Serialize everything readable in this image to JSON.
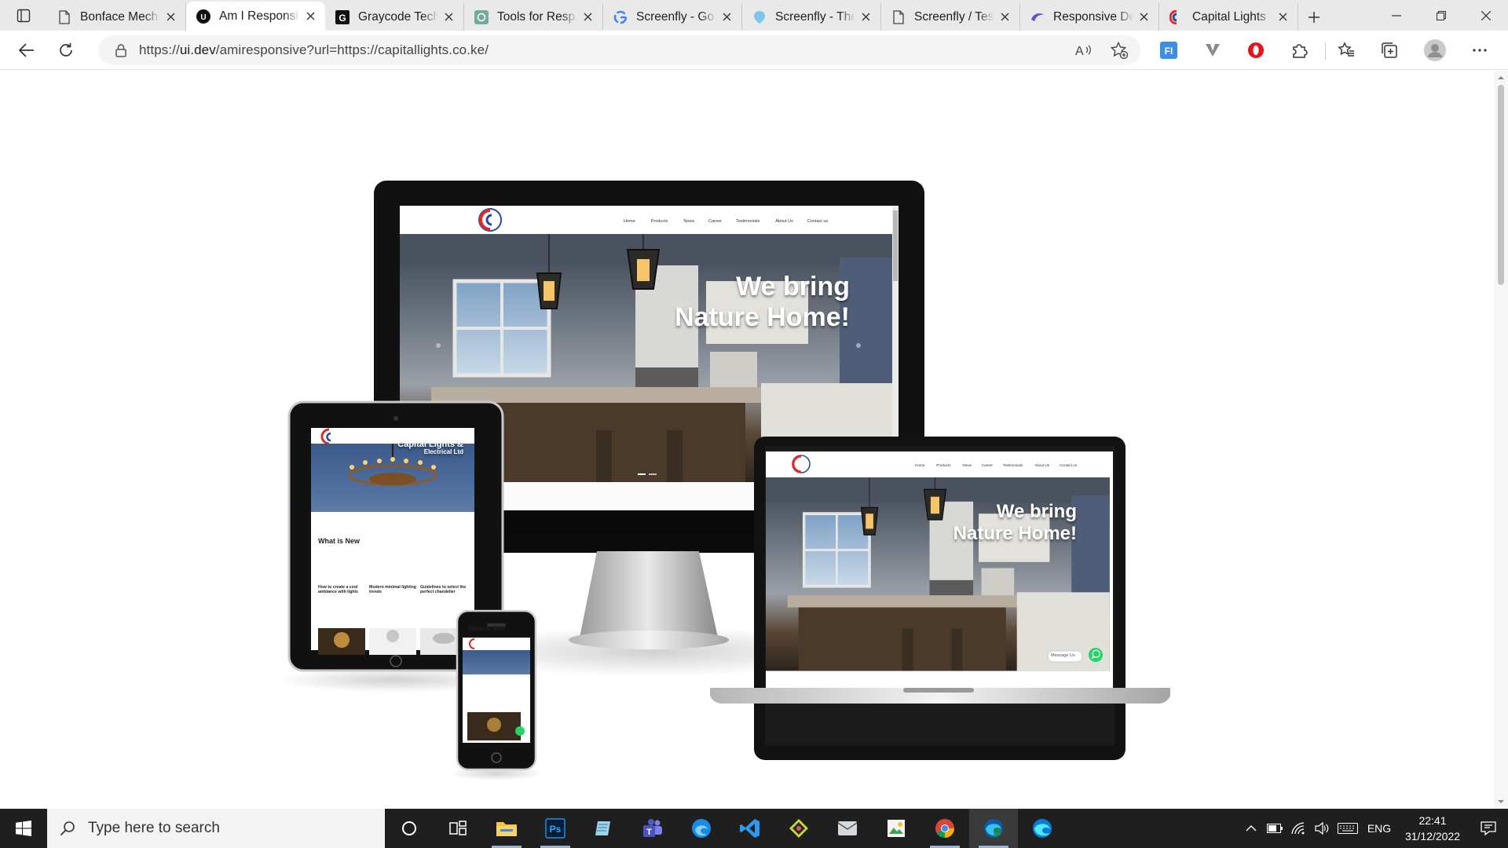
{
  "browser": {
    "tabs": [
      {
        "title": "Bonface Mech",
        "icon": "page-icon"
      },
      {
        "title": "Am I Responsi",
        "icon": "uidev-icon",
        "active": true
      },
      {
        "title": "Graycode Tech",
        "icon": "graycode-icon"
      },
      {
        "title": "Tools for Resp",
        "icon": "openai-icon"
      },
      {
        "title": "Screenfly - Go",
        "icon": "google-icon"
      },
      {
        "title": "Screenfly - The",
        "icon": "screenfly-icon"
      },
      {
        "title": "Screenfly / Tes",
        "icon": "page-icon"
      },
      {
        "title": "Responsive De",
        "icon": "responsive-icon"
      },
      {
        "title": "Capital Lights",
        "icon": "capital-lights-icon"
      }
    ],
    "address": {
      "prefix": "https://",
      "host": "ui.dev",
      "path": "/amiresponsive?url=https://capitallights.co.ke/"
    }
  },
  "site": {
    "nav": [
      "Home",
      "Products",
      "News",
      "Career",
      "Testimonials",
      "About Us",
      "Contact us"
    ],
    "hero_line1": "We bring",
    "hero_line2": "Nature Home!",
    "tablet_title1": "Capital Lights &",
    "tablet_title2": "Electrical Ltd",
    "whats_new": "What is New",
    "cards": [
      {
        "title": "How to create a cool ambiance with lights"
      },
      {
        "title": "Modern minimal lighting trends"
      },
      {
        "title": "Guidelines to select the perfect chandelier"
      }
    ],
    "message_us": "Message Us"
  },
  "taskbar": {
    "search_placeholder": "Type here to search",
    "lang": "ENG",
    "time": "22:41",
    "date": "31/12/2022",
    "apps": [
      "cortana-icon",
      "task-view-icon",
      "file-explorer-icon",
      "photoshop-icon",
      "notepad-icon",
      "teams-icon",
      "edge-beta-icon",
      "vscode-icon",
      "gitkraken-icon",
      "outlook-icon",
      "spreadsheet-icon",
      "chrome-icon",
      "edge-icon",
      "edge-dev-icon"
    ]
  },
  "colors": {
    "accent": "#0f6cbd",
    "taskbar": "#1f1f1f",
    "brand_red": "#e02a2a",
    "brand_blue": "#1f4fa8"
  }
}
